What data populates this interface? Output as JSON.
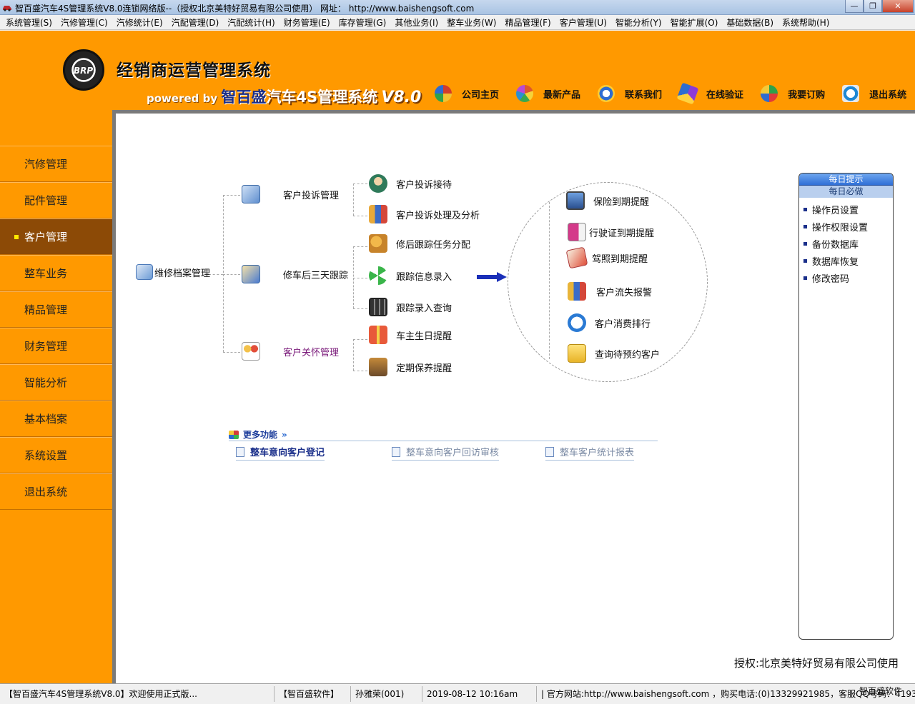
{
  "window": {
    "title": "智百盛汽车4S管理系统V8.0连锁网络版--（授权北京美特好贸易有限公司使用） 网址： http://www.baishengsoft.com",
    "minimize": "—",
    "maximize": "❐",
    "close": "✕"
  },
  "menu": [
    "系统管理(S)",
    "汽修管理(C)",
    "汽修统计(E)",
    "汽配管理(D)",
    "汽配统计(H)",
    "财务管理(E)",
    "库存管理(G)",
    "其他业务(I)",
    "整车业务(W)",
    "精品管理(F)",
    "客户管理(U)",
    "智能分析(Y)",
    "智能扩展(O)",
    "基础数据(B)",
    "系统帮助(H)"
  ],
  "header": {
    "logo_text": "BRP",
    "app_name": "经销商运营管理系统",
    "powered": "powered by",
    "brand": "智百盛",
    "product": "汽车4S管理系统",
    "version": "V8.0"
  },
  "topnav": [
    {
      "label": "公司主页",
      "icon": "pinwheel-icon",
      "color": "#d23c2c"
    },
    {
      "label": "最新产品",
      "icon": "flower-icon",
      "color": "#e0572b"
    },
    {
      "label": "联系我们",
      "icon": "link-icon",
      "color": "#2e6cd1"
    },
    {
      "label": "在线验证",
      "icon": "star-icon",
      "color": "#8d3bd6"
    },
    {
      "label": "我要订购",
      "icon": "cart-icon",
      "color": "#2fa24a"
    },
    {
      "label": "退出系统",
      "icon": "exit-icon",
      "color": "#1e88d4"
    }
  ],
  "sidebar": [
    {
      "label": "汽修管理",
      "active": false
    },
    {
      "label": "配件管理",
      "active": false
    },
    {
      "label": "客户管理",
      "active": true
    },
    {
      "label": "整车业务",
      "active": false
    },
    {
      "label": "精品管理",
      "active": false
    },
    {
      "label": "财务管理",
      "active": false
    },
    {
      "label": "智能分析",
      "active": false
    },
    {
      "label": "基本档案",
      "active": false
    },
    {
      "label": "系统设置",
      "active": false
    },
    {
      "label": "退出系统",
      "active": false
    }
  ],
  "tree": {
    "root": "维修档案管理",
    "groups": [
      {
        "label": "客户投诉管理",
        "children": [
          "客户投诉接待",
          "客户投诉处理及分析"
        ]
      },
      {
        "label": "修车后三天跟踪",
        "children": [
          "修后跟踪任务分配",
          "跟踪信息录入",
          "跟踪录入查询"
        ]
      },
      {
        "label": "客户关怀管理",
        "children": [
          "车主生日提醒",
          "定期保养提醒"
        ]
      }
    ],
    "reminders": [
      "保险到期提醒",
      "行驶证到期提醒",
      "驾照到期提醒",
      "客户流失报警",
      "客户消费排行",
      "查询待预约客户"
    ]
  },
  "more": {
    "title": "更多功能",
    "chevron": "»",
    "links": [
      "整车意向客户登记",
      "整车意向客户回访审核",
      "整车客户统计报表"
    ]
  },
  "tips": {
    "header": "每日提示",
    "subheader": "每日必做",
    "items": [
      "操作员设置",
      "操作权限设置",
      "备份数据库",
      "数据库恢复",
      "修改密码"
    ]
  },
  "license": "授权:北京美特好贸易有限公司使用",
  "status": {
    "welcome": "【智百盛汽车4S管理系统V8.0】欢迎使用正式版...",
    "vendor": "【智百盛软件】",
    "user": "孙雅荣(001)",
    "datetime": "2019-08-12 10:16am",
    "contact": "| 官方网站:http://www.baishengsoft.com ，购买电话:(0)13329921985，客服QQ号码：4193",
    "watermark": "智百盛软件"
  }
}
